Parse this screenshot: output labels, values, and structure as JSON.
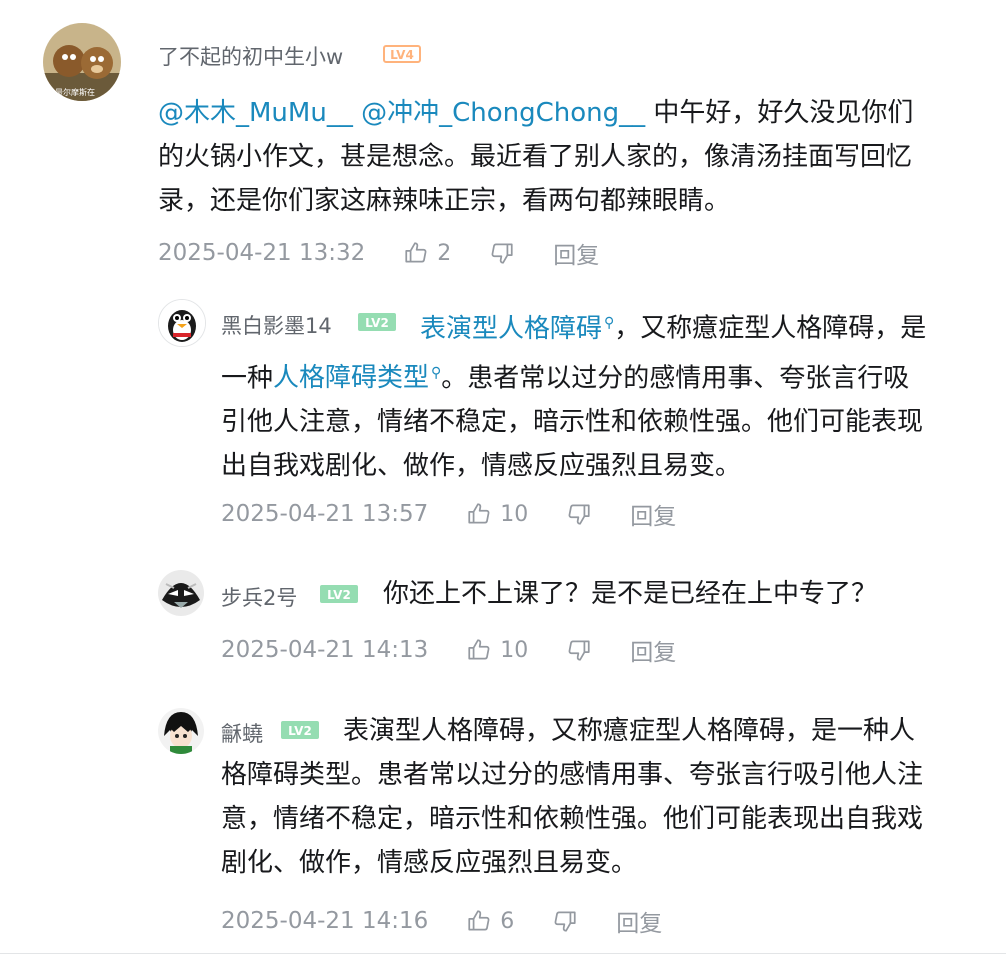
{
  "root": {
    "username": "了不起的初中生小w",
    "level": "LV4",
    "level_color": "#ffb37c",
    "avatar_caption": "最尔摩斯在",
    "mentions": [
      "@木木_MuMu__",
      "@冲冲_ChongChong__"
    ],
    "text_line1": " 中午好，好久没见你们",
    "text_line2": "的火锅小作文，甚是想念。最近看了别人家的，像清汤挂面写回忆",
    "text_line3": "录，还是你们家这麻辣味正宗，看两句都辣眼睛。",
    "time": "2025-04-21 13:32",
    "likes": "2",
    "reply_label": "回复"
  },
  "replies": [
    {
      "username": "黑白影墨14",
      "level": "LV2",
      "level_color": "#95ddb2",
      "kw1": "表演型人格障碍",
      "text_a": "，又称癔症型人格障碍，是",
      "text_b": "一种",
      "kw2": "人格障碍类型",
      "text_c": "。患者常以过分的感情用事、夸张言行吸",
      "text_d": "引他人注意，情绪不稳定，暗示性和依赖性强。他们可能表现",
      "text_e": "出自我戏剧化、做作，情感反应强烈且易变。",
      "time": "2025-04-21 13:57",
      "likes": "10",
      "reply_label": "回复"
    },
    {
      "username": "步兵2号",
      "level": "LV2",
      "level_color": "#95ddb2",
      "text": "你还上不上课了？是不是已经在上中专了？",
      "time": "2025-04-21 14:13",
      "likes": "10",
      "reply_label": "回复"
    },
    {
      "username": "龢蟯",
      "level": "LV2",
      "level_color": "#95ddb2",
      "text_a": "表演型人格障碍，又称癔症型人格障碍，是一种人",
      "text_b": "格障碍类型。患者常以过分的感情用事、夸张言行吸引他人注",
      "text_c": "意，情绪不稳定，暗示性和依赖性强。他们可能表现出自我戏",
      "text_d": "剧化、做作，情感反应强烈且易变。",
      "time": "2025-04-21 14:16",
      "likes": "6",
      "reply_label": "回复"
    }
  ],
  "colors": {
    "link": "#1a89bd",
    "meta": "#9499a0",
    "username": "#61666d",
    "text": "#18191c"
  },
  "icons": {
    "like": "thumbs-up-icon",
    "dislike": "thumbs-down-icon",
    "keyword_search": "search-icon"
  }
}
